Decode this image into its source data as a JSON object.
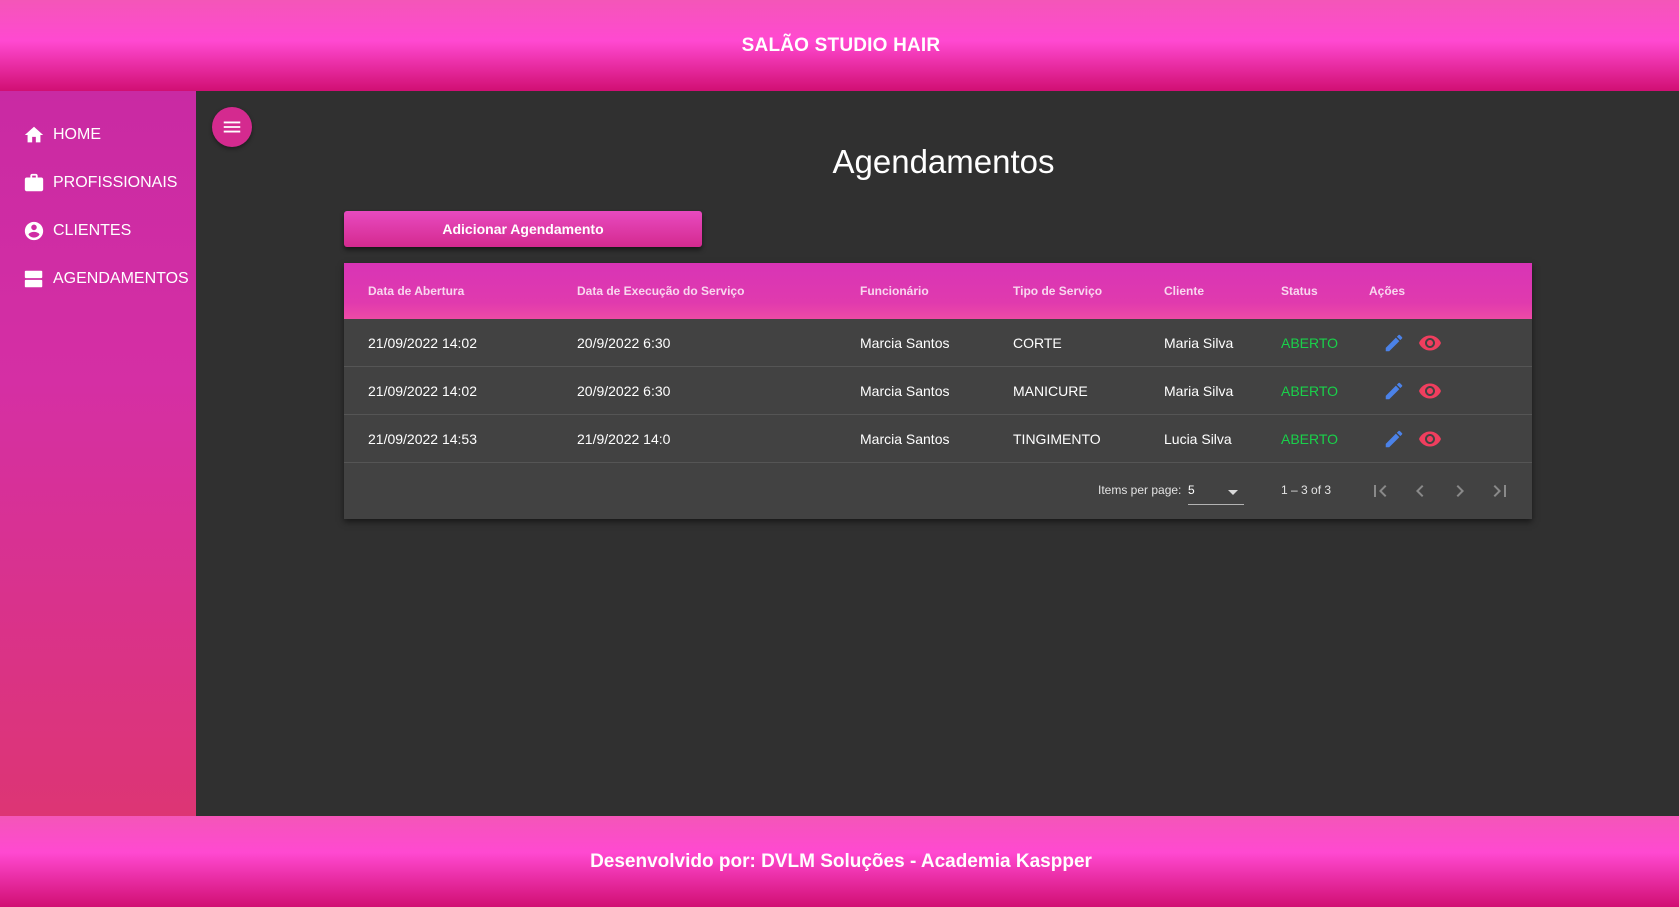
{
  "header": {
    "title": "SALÃO STUDIO HAIR"
  },
  "sidebar": {
    "items": [
      {
        "label": "HOME",
        "icon": "home-icon"
      },
      {
        "label": "PROFISSIONAIS",
        "icon": "briefcase-icon"
      },
      {
        "label": "CLIENTES",
        "icon": "account-circle-icon"
      },
      {
        "label": "AGENDAMENTOS",
        "icon": "view-agenda-icon"
      }
    ]
  },
  "main": {
    "menu_icon": "menu-icon",
    "title": "Agendamentos",
    "add_button": "Adicionar Agendamento",
    "table": {
      "headers": [
        "Data de Abertura",
        "Data de Execução do Serviço",
        "Funcionário",
        "Tipo de Serviço",
        "Cliente",
        "Status",
        "Ações"
      ],
      "rows": [
        {
          "abertura": "21/09/2022 14:02",
          "execucao": "20/9/2022 6:30",
          "funcionario": "Marcia Santos",
          "servico": "CORTE",
          "cliente": "Maria Silva",
          "status": "ABERTO"
        },
        {
          "abertura": "21/09/2022 14:02",
          "execucao": "20/9/2022 6:30",
          "funcionario": "Marcia Santos",
          "servico": "MANICURE",
          "cliente": "Maria Silva",
          "status": "ABERTO"
        },
        {
          "abertura": "21/09/2022 14:53",
          "execucao": "21/9/2022 14:0",
          "funcionario": "Marcia Santos",
          "servico": "TINGIMENTO",
          "cliente": "Lucia Silva",
          "status": "ABERTO"
        }
      ]
    },
    "paginator": {
      "items_per_page_label": "Items per page:",
      "items_per_page_value": "5",
      "range_label": "1 – 3 of 3"
    }
  },
  "footer": {
    "text": "Desenvolvido por: DVLM Soluções - Academia Kaspper"
  },
  "colors": {
    "accent": "#d42a8f",
    "status_open": "#19d14a",
    "edit_icon": "#4b82e8",
    "view_icon": "#f03e5e",
    "background": "#303030",
    "card": "#424242"
  }
}
